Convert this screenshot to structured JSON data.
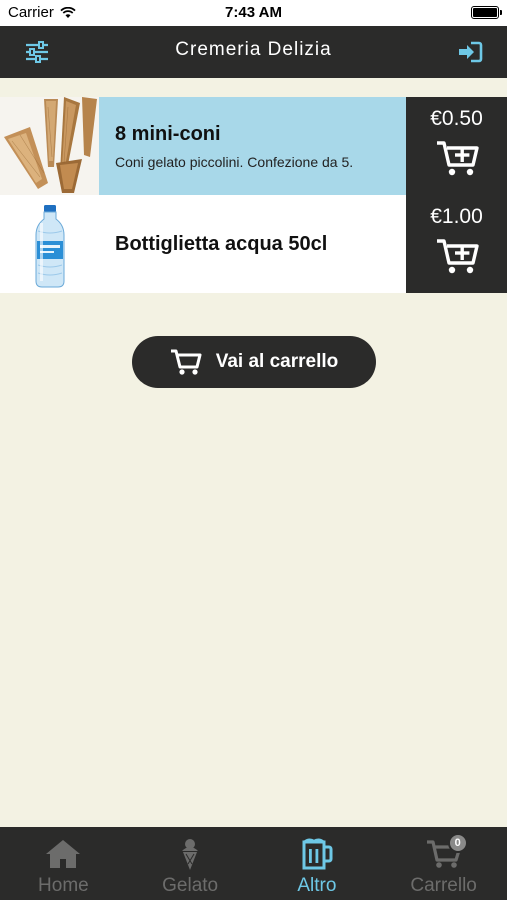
{
  "status_bar": {
    "carrier": "Carrier",
    "time": "7:43 AM"
  },
  "nav": {
    "title": "Cremeria Delizia",
    "left_icon": "sliders-icon",
    "right_icon": "login-icon"
  },
  "products": [
    {
      "name": "8 mini-coni",
      "description": "Coni gelato piccolini. Confezione da 5.",
      "price": "€0.50",
      "image": "cones-image",
      "selected": true
    },
    {
      "name": "Bottiglietta acqua 50cl",
      "description": "",
      "price": "€1.00",
      "image": "water-bottle-image",
      "selected": false
    }
  ],
  "go_cart": {
    "label": "Vai al carrello",
    "icon": "cart-icon"
  },
  "tabs": [
    {
      "label": "Home",
      "icon": "home-icon",
      "active": false
    },
    {
      "label": "Gelato",
      "icon": "ice-cream-icon",
      "active": false
    },
    {
      "label": "Altro",
      "icon": "drink-icon",
      "active": true
    },
    {
      "label": "Carrello",
      "icon": "cart-icon",
      "active": false,
      "badge": "0"
    }
  ],
  "colors": {
    "background": "#f3f2e3",
    "dark": "#2b2b2a",
    "accent": "#6ec8e6",
    "selected_row": "#a8d8e9",
    "inactive_tab": "#6c6c6b"
  }
}
